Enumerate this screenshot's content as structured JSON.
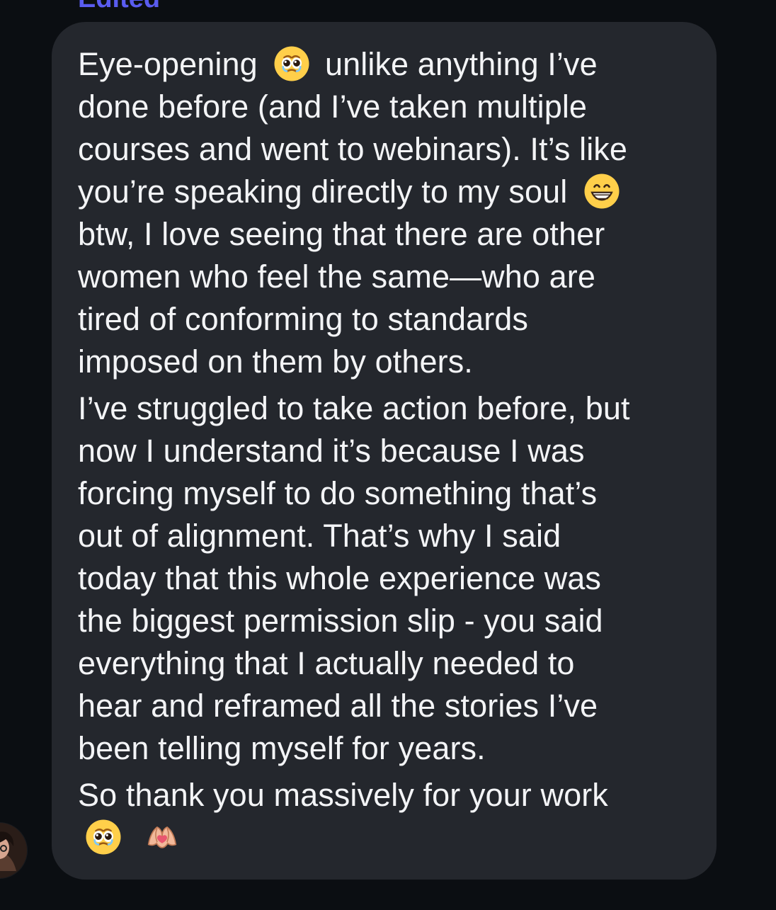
{
  "header": {
    "edited_label": "Edited"
  },
  "message": {
    "lines": [
      [
        "Eye-opening ",
        "emoji:pleading-face",
        " unlike anything I’ve"
      ],
      [
        "done before (and I’ve taken multiple"
      ],
      [
        "courses and went to webinars). It’s like"
      ],
      [
        "you’re speaking directly to my soul ",
        "emoji:grinning-face"
      ],
      [
        "btw, I love seeing that there are other"
      ],
      [
        "women who feel the same—who are"
      ],
      [
        "tired of conforming to standards"
      ],
      [
        "imposed on them by others."
      ],
      [
        "I’ve struggled to take action before, but"
      ],
      [
        "now I understand it’s because I was"
      ],
      [
        "forcing myself to do something that’s"
      ],
      [
        "out of alignment. That’s why I said"
      ],
      [
        "today that this whole experience was"
      ],
      [
        "the biggest permission slip - you said"
      ],
      [
        "everything that I actually needed to"
      ],
      [
        "hear and reframed all the stories I’ve"
      ],
      [
        "been telling myself for years."
      ],
      [
        "So thank you massively for your work"
      ],
      [
        "emoji:pleading-face",
        " ",
        "emoji:heart-hands"
      ]
    ]
  },
  "icons": {
    "emoji_pleading_face": "pleading-face-icon",
    "emoji_grinning_face": "grinning-face-icon",
    "emoji_heart_hands": "heart-hands-icon",
    "avatar": "avatar"
  },
  "colors": {
    "background": "#0b0e12",
    "bubble": "#24272d",
    "text": "#f3f4f6",
    "edited_label": "#5a5cf0"
  }
}
